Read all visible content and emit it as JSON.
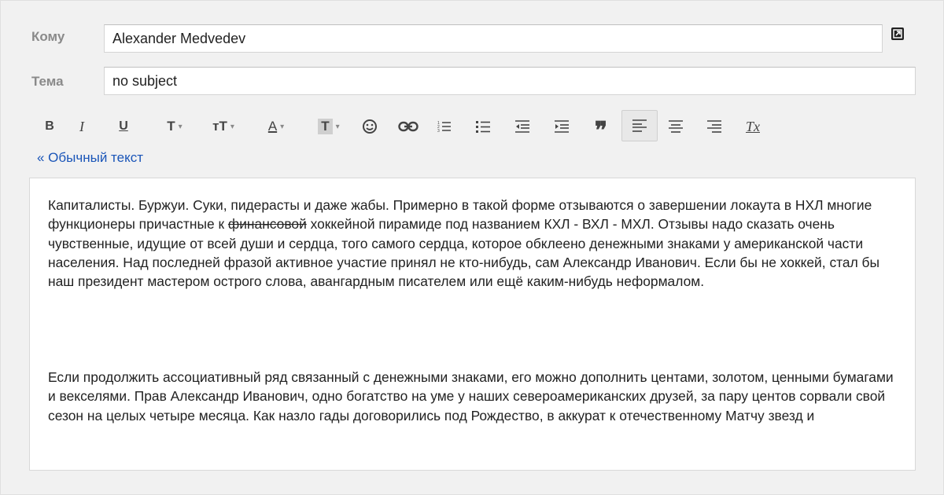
{
  "to": {
    "label": "Кому",
    "value": "Alexander Medvedev"
  },
  "subject": {
    "label": "Тема",
    "value": "no subject"
  },
  "popout_icon": "popout-icon",
  "toolbar": {
    "bold": "B",
    "italic": "I",
    "underline": "U",
    "font": "T",
    "size": "тT",
    "text_color": "A",
    "highlight": "T",
    "emoji_icon": "emoji-icon",
    "link_icon": "link-icon",
    "numbered_icon": "numbered-list-icon",
    "bulleted_icon": "bulleted-list-icon",
    "indent_less_icon": "indent-less-icon",
    "indent_more_icon": "indent-more-icon",
    "quote": "❞",
    "align_left_icon": "align-left-icon",
    "align_center_icon": "align-center-icon",
    "align_right_icon": "align-right-icon",
    "clear_format": "Tx"
  },
  "plain_text_link": "« Обычный текст",
  "message": {
    "p1_before": "Капиталисты. Буржуи. Суки, пидерасты и даже жабы. Примерно в такой форме отзываются о завершении локаута в НХЛ многие функционеры причастные к ",
    "p1_strike": "финансовой",
    "p1_after": " хоккейной пирамиде под названием КХЛ - ВХЛ - МХЛ. Отзывы надо сказать очень чувственные, идущие от всей души и сердца, того самого сердца, которое обклеено денежными знаками у американской части населения. Над последней фразой активное участие принял не кто-нибудь, сам Александр Иванович. Если бы не хоккей, стал бы наш президент мастером острого слова, авангардным писателем или ещё каким-нибудь неформалом.",
    "p2": "Если продолжить ассоциативный ряд связанный с денежными знаками, его можно дополнить центами, золотом, ценными бумагами и векселями. Прав Александр Иванович, одно богатство на уме у наших североамериканских друзей, за пару центов сорвали свой сезон на целых четыре месяца. Как назло гады договорились под Рождество, в аккурат к отечественному Матчу звезд и"
  },
  "colors": {
    "background": "#f1f1f1",
    "link": "#1a55b8",
    "label": "#8a8a8a",
    "active_button": "#e8e8e8"
  }
}
